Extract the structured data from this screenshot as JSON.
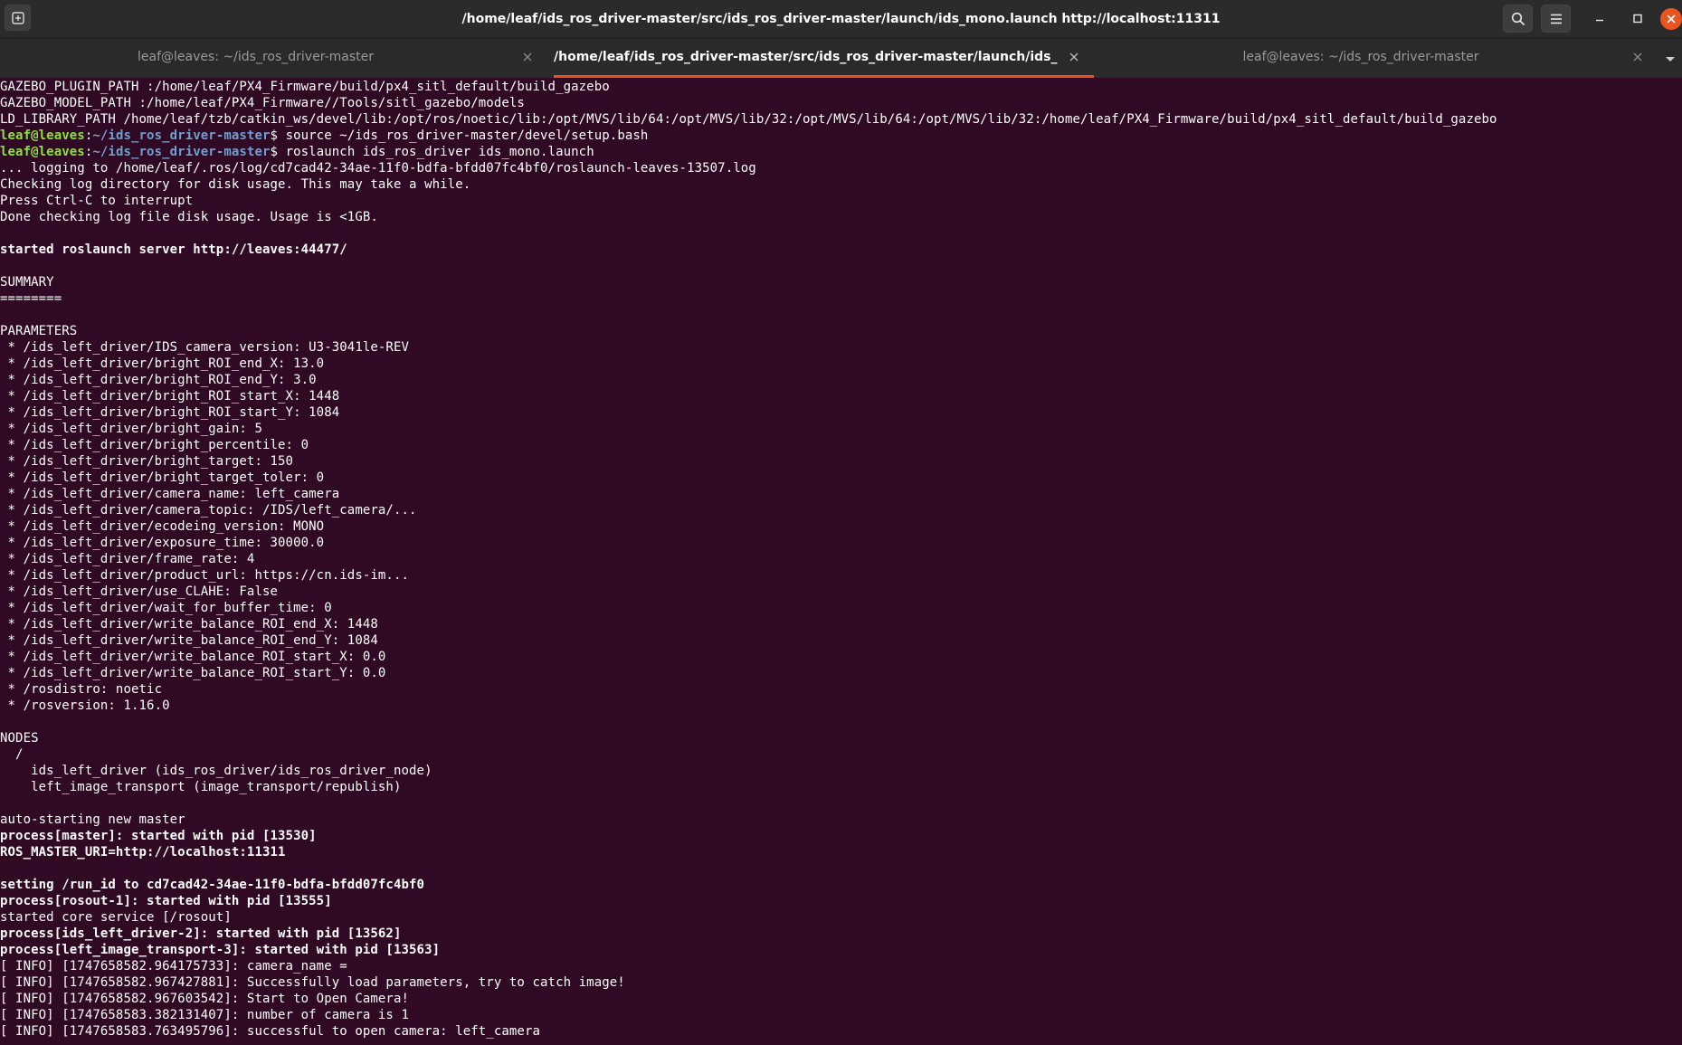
{
  "window": {
    "title": "/home/leaf/ids_ros_driver-master/src/ids_ros_driver-master/launch/ids_mono.launch http://localhost:11311"
  },
  "icons": {
    "new_tab": "new-tab-icon",
    "search": "search-icon",
    "menu": "hamburger-menu-icon",
    "minimize": "minimize-icon",
    "maximize": "maximize-icon",
    "close": "close-icon",
    "tab_close": "close-icon",
    "tabs_dropdown": "chevron-down-icon"
  },
  "colors": {
    "terminal_background": "#300a24",
    "accent": "#e95420",
    "prompt_user": "#8ae234",
    "prompt_path": "#729fcf"
  },
  "tabs": [
    {
      "label": "leaf@leaves: ~/ids_ros_driver-master",
      "active": false
    },
    {
      "label": "/home/leaf/ids_ros_driver-master/src/ids_ros_driver-master/launch/ids_mo...",
      "active": true
    },
    {
      "label": "leaf@leaves: ~/ids_ros_driver-master",
      "active": false
    }
  ],
  "terminal": {
    "lines": [
      {
        "text": "GAZEBO_PLUGIN_PATH :/home/leaf/PX4_Firmware/build/px4_sitl_default/build_gazebo"
      },
      {
        "text": "GAZEBO_MODEL_PATH :/home/leaf/PX4_Firmware//Tools/sitl_gazebo/models"
      },
      {
        "text": "LD_LIBRARY_PATH /home/leaf/tzb/catkin_ws/devel/lib:/opt/ros/noetic/lib:/opt/MVS/lib/64:/opt/MVS/lib/32:/opt/MVS/lib/64:/opt/MVS/lib/32:/home/leaf/PX4_Firmware/build/px4_sitl_default/build_gazebo"
      },
      {
        "prompt": {
          "user": "leaf@leaves",
          "colon": ":",
          "path": "~/ids_ros_driver-master",
          "dollar": "$ "
        },
        "command": "source ~/ids_ros_driver-master/devel/setup.bash"
      },
      {
        "prompt": {
          "user": "leaf@leaves",
          "colon": ":",
          "path": "~/ids_ros_driver-master",
          "dollar": "$ "
        },
        "command": "roslaunch ids_ros_driver ids_mono.launch"
      },
      {
        "text": "... logging to /home/leaf/.ros/log/cd7cad42-34ae-11f0-bdfa-bfdd07fc4bf0/roslaunch-leaves-13507.log"
      },
      {
        "text": "Checking log directory for disk usage. This may take a while."
      },
      {
        "text": "Press Ctrl-C to interrupt"
      },
      {
        "text": "Done checking log file disk usage. Usage is <1GB."
      },
      {
        "text": ""
      },
      {
        "text": "started roslaunch server http://leaves:44477/",
        "bold": true
      },
      {
        "text": ""
      },
      {
        "text": "SUMMARY"
      },
      {
        "text": "========"
      },
      {
        "text": ""
      },
      {
        "text": "PARAMETERS"
      },
      {
        "text": " * /ids_left_driver/IDS_camera_version: U3-3041le-REV"
      },
      {
        "text": " * /ids_left_driver/bright_ROI_end_X: 13.0"
      },
      {
        "text": " * /ids_left_driver/bright_ROI_end_Y: 3.0"
      },
      {
        "text": " * /ids_left_driver/bright_ROI_start_X: 1448"
      },
      {
        "text": " * /ids_left_driver/bright_ROI_start_Y: 1084"
      },
      {
        "text": " * /ids_left_driver/bright_gain: 5"
      },
      {
        "text": " * /ids_left_driver/bright_percentile: 0"
      },
      {
        "text": " * /ids_left_driver/bright_target: 150"
      },
      {
        "text": " * /ids_left_driver/bright_target_toler: 0"
      },
      {
        "text": " * /ids_left_driver/camera_name: left_camera"
      },
      {
        "text": " * /ids_left_driver/camera_topic: /IDS/left_camera/..."
      },
      {
        "text": " * /ids_left_driver/ecodeing_version: MONO"
      },
      {
        "text": " * /ids_left_driver/exposure_time: 30000.0"
      },
      {
        "text": " * /ids_left_driver/frame_rate: 4"
      },
      {
        "text": " * /ids_left_driver/product_url: https://cn.ids-im..."
      },
      {
        "text": " * /ids_left_driver/use_CLAHE: False"
      },
      {
        "text": " * /ids_left_driver/wait_for_buffer_time: 0"
      },
      {
        "text": " * /ids_left_driver/write_balance_ROI_end_X: 1448"
      },
      {
        "text": " * /ids_left_driver/write_balance_ROI_end_Y: 1084"
      },
      {
        "text": " * /ids_left_driver/write_balance_ROI_start_X: 0.0"
      },
      {
        "text": " * /ids_left_driver/write_balance_ROI_start_Y: 0.0"
      },
      {
        "text": " * /rosdistro: noetic"
      },
      {
        "text": " * /rosversion: 1.16.0"
      },
      {
        "text": ""
      },
      {
        "text": "NODES"
      },
      {
        "text": "  /"
      },
      {
        "text": "    ids_left_driver (ids_ros_driver/ids_ros_driver_node)"
      },
      {
        "text": "    left_image_transport (image_transport/republish)"
      },
      {
        "text": ""
      },
      {
        "text": "auto-starting new master"
      },
      {
        "text": "process[master]: started with pid [13530]",
        "bold": true
      },
      {
        "text": "ROS_MASTER_URI=http://localhost:11311",
        "bold": true
      },
      {
        "text": ""
      },
      {
        "text": "setting /run_id to cd7cad42-34ae-11f0-bdfa-bfdd07fc4bf0",
        "bold": true
      },
      {
        "text": "process[rosout-1]: started with pid [13555]",
        "bold": true
      },
      {
        "text": "started core service [/rosout]"
      },
      {
        "text": "process[ids_left_driver-2]: started with pid [13562]",
        "bold": true
      },
      {
        "text": "process[left_image_transport-3]: started with pid [13563]",
        "bold": true
      },
      {
        "text": "[ INFO] [1747658582.964175733]: camera_name = "
      },
      {
        "text": "[ INFO] [1747658582.967427881]: Successfully load parameters, try to catch image!"
      },
      {
        "text": "[ INFO] [1747658582.967603542]: Start to Open Camera!"
      },
      {
        "text": "[ INFO] [1747658583.382131407]: number of camera is 1"
      },
      {
        "text": "[ INFO] [1747658583.763495796]: successful to open camera: left_camera"
      }
    ]
  }
}
